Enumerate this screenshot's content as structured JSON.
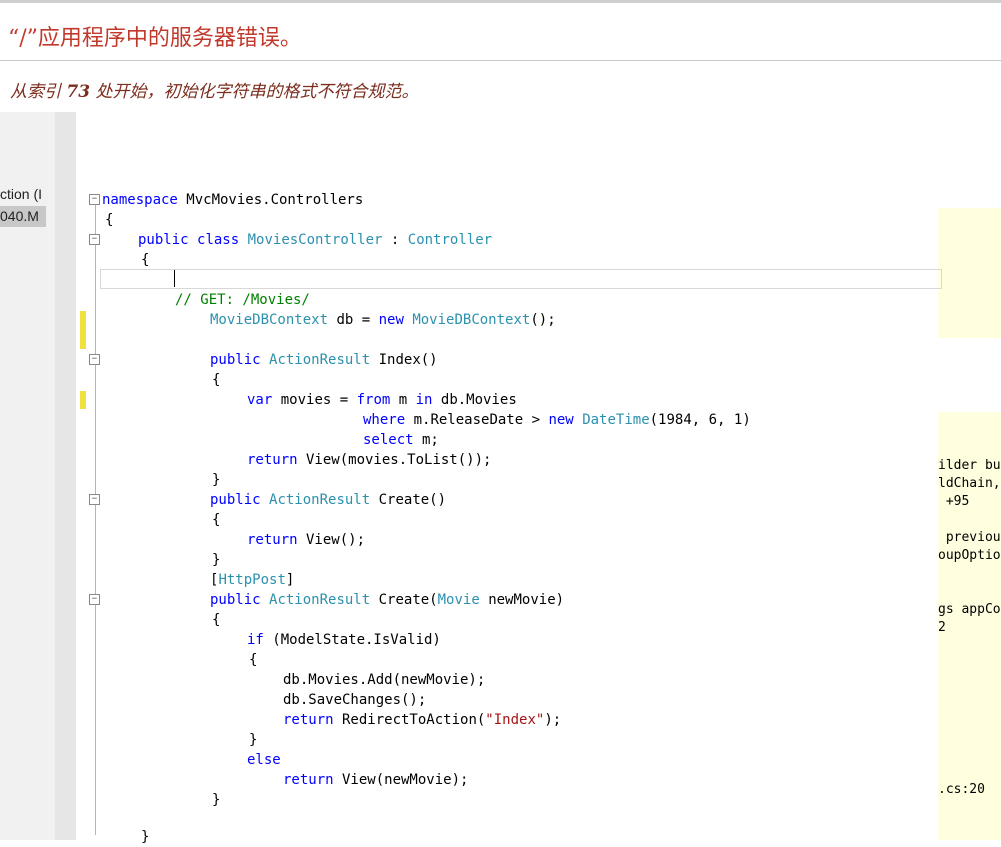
{
  "error_page": {
    "title": "“/”应用程序中的服务器错误。",
    "description_before": "从索引 ",
    "description_index": "73",
    "description_after": " 处开始，初始化字符串的格式不符合规范。"
  },
  "left_panel": {
    "fragment_1": "ction (I",
    "fragment_2": "040.M"
  },
  "code_lines": {
    "l1_kw": "namespace",
    "l1_rest": " MvcMovies.Controllers",
    "l2": "{",
    "l3_kw1": "public",
    "l3_kw2": "class",
    "l3_type1": "MoviesController",
    "l3_sep": " : ",
    "l3_type2": "Controller",
    "l4": "{",
    "l6_comment": "// GET: /Movies/",
    "l7_type1": "MovieDBContext",
    "l7_mid": " db = ",
    "l7_kw": "new",
    "l7_type2": "MovieDBContext",
    "l7_end": "();",
    "l9_kw": "public",
    "l9_type": "ActionResult",
    "l9_rest": " Index()",
    "l10": "{",
    "l11_kw1": "var",
    "l11_mid1": " movies = ",
    "l11_kw2": "from",
    "l11_mid2": " m ",
    "l11_kw3": "in",
    "l11_rest": " db.Movies",
    "l12_kw1": "where",
    "l12_mid": " m.ReleaseDate > ",
    "l12_kw2": "new",
    "l12_type": "DateTime",
    "l12_rest": "(1984, 6, 1)",
    "l13_kw": "select",
    "l13_rest": " m;",
    "l14_kw": "return",
    "l14_rest": " View(movies.ToList());",
    "l15": "}",
    "l16_kw": "public",
    "l16_type": "ActionResult",
    "l16_rest": " Create()",
    "l17": "{",
    "l18_kw": "return",
    "l18_rest": " View();",
    "l19": "}",
    "l20_open": "[",
    "l20_type": "HttpPost",
    "l20_close": "]",
    "l21_kw": "public",
    "l21_type1": "ActionResult",
    "l21_mid": " Create(",
    "l21_type2": "Movie",
    "l21_rest": " newMovie)",
    "l22": "{",
    "l23_kw": "if",
    "l23_rest": " (ModelState.IsValid)",
    "l24": "{",
    "l25": "db.Movies.Add(newMovie);",
    "l26": "db.SaveChanges();",
    "l27_kw": "return",
    "l27_mid": " RedirectToAction(",
    "l27_str": "\"Index\"",
    "l27_end": ");",
    "l28": "}",
    "l29_kw": "else",
    "l30_kw": "return",
    "l30_rest": " View(newMovie);",
    "l31": "}",
    "l33": "}"
  },
  "right_panel": {
    "r1": "ilder bu",
    "r2": "ldChain,",
    "r3": " +95",
    "r4": " previou",
    "r5": "oupOptio",
    "r6": "gs appCo",
    "r7": "2",
    "r8": ".cs:20"
  },
  "colors": {
    "title_red": "#c0392b",
    "keyword_blue": "#0000ff",
    "type_teal": "#2b91af",
    "comment_green": "#008000",
    "string_red": "#a31515",
    "stack_trace_bg": "#ffffe0"
  }
}
